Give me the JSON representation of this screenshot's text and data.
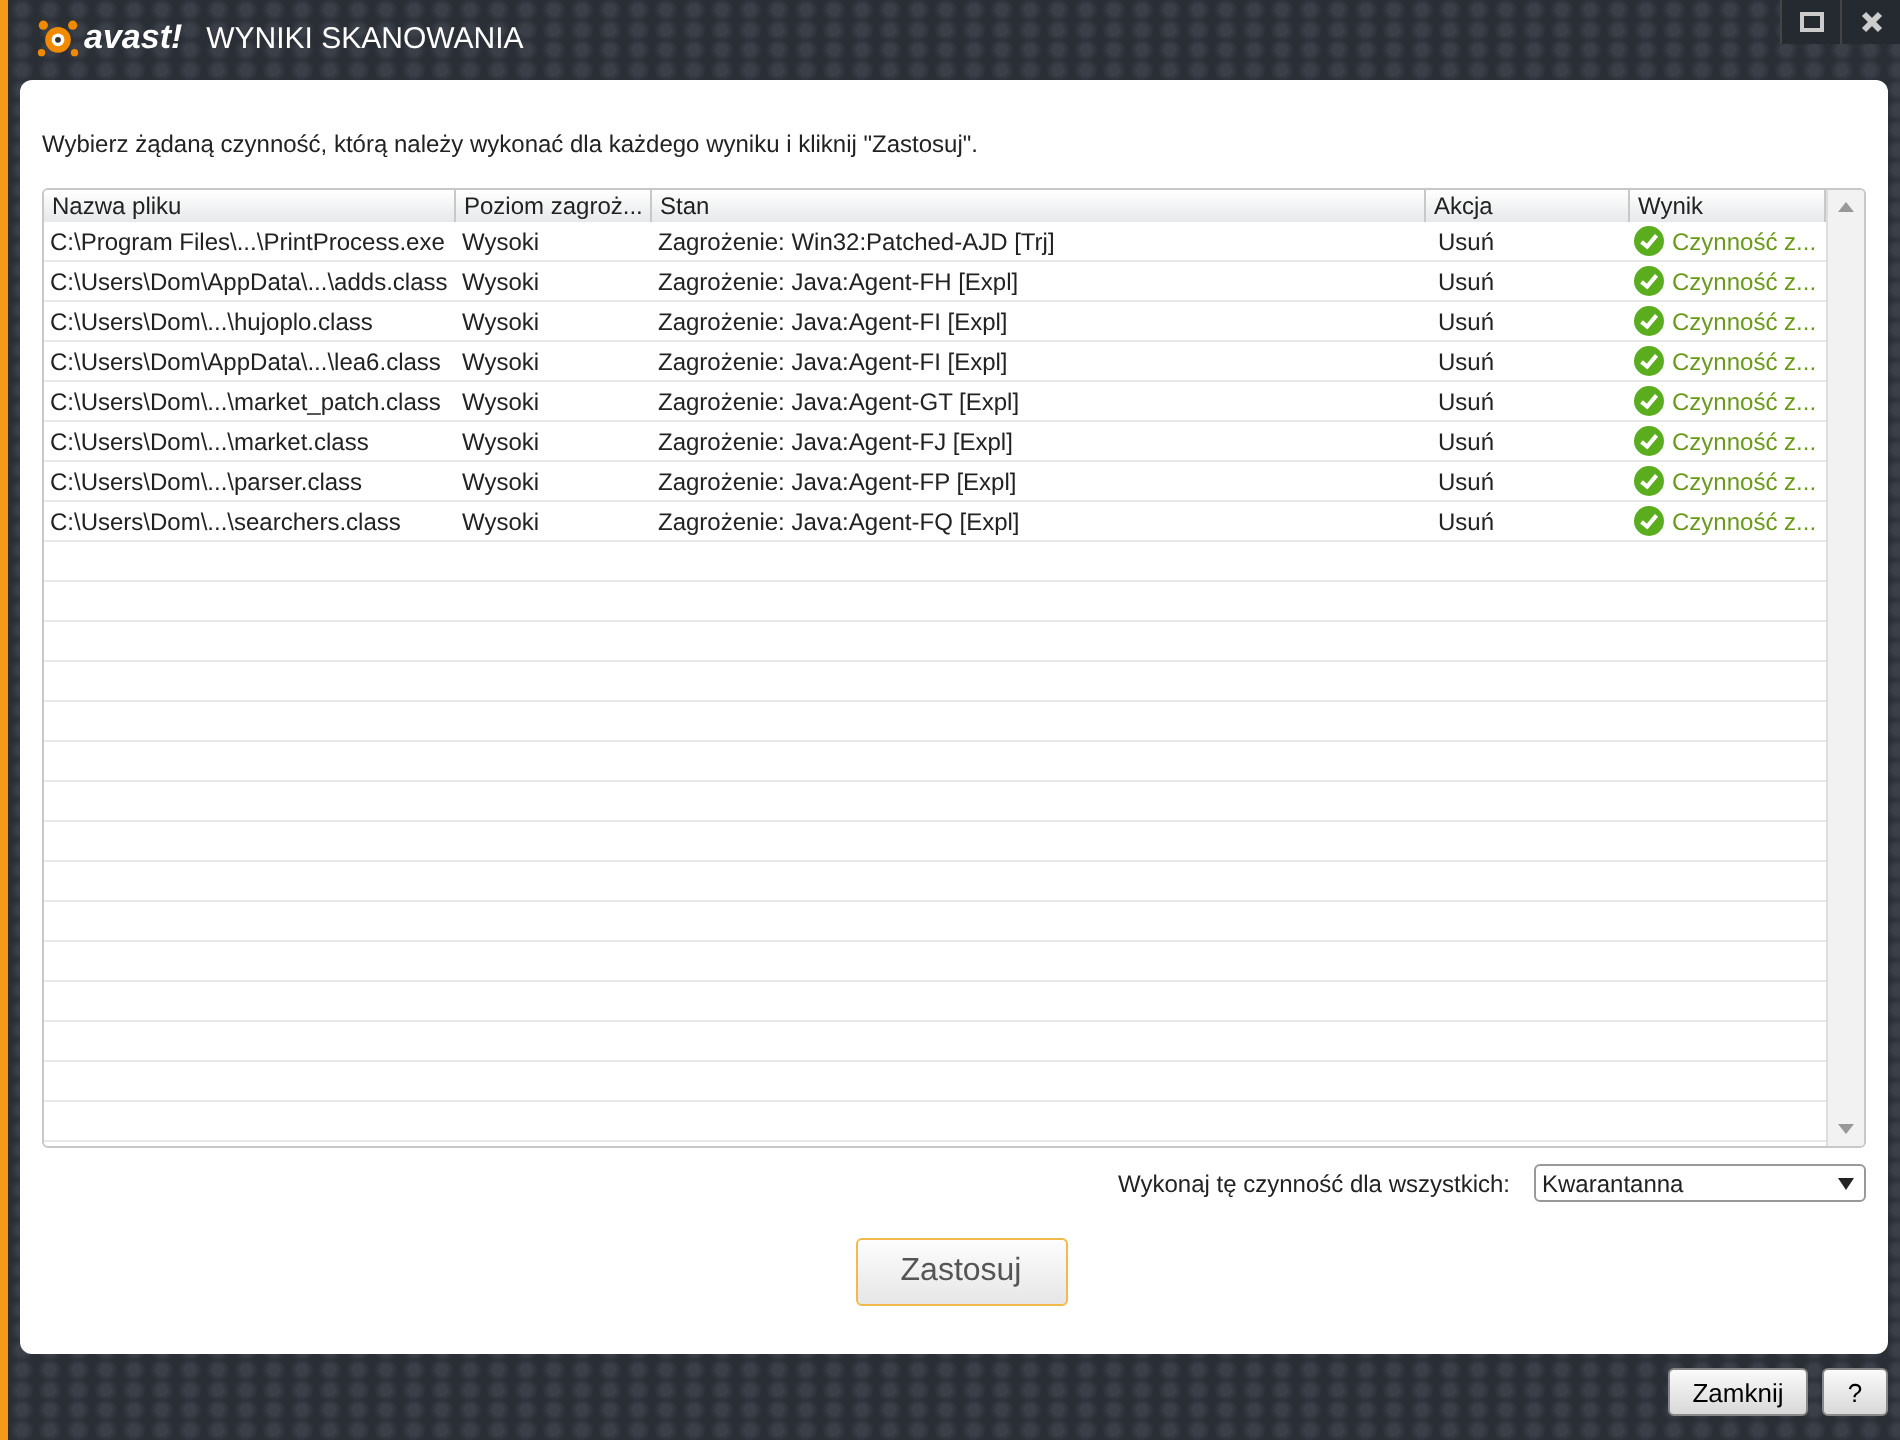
{
  "window": {
    "logo": "avast!",
    "title": "WYNIKI SKANOWANIA"
  },
  "instruction": "Wybierz żądaną czynność, którą należy wykonać dla każdego wyniku i kliknij \"Zastosuj\".",
  "table": {
    "columns": [
      "Nazwa pliku",
      "Poziom zagroż...",
      "Stan",
      "Akcja",
      "Wynik"
    ],
    "rows": [
      {
        "file": "C:\\Program Files\\...\\PrintProcess.exe",
        "level": "Wysoki",
        "status": "Zagrożenie: Win32:Patched-AJD [Trj]",
        "action": "Usuń",
        "result": "Czynność z..."
      },
      {
        "file": "C:\\Users\\Dom\\AppData\\...\\adds.class",
        "level": "Wysoki",
        "status": "Zagrożenie: Java:Agent-FH [Expl]",
        "action": "Usuń",
        "result": "Czynność z..."
      },
      {
        "file": "C:\\Users\\Dom\\...\\hujoplo.class",
        "level": "Wysoki",
        "status": "Zagrożenie: Java:Agent-FI [Expl]",
        "action": "Usuń",
        "result": "Czynność z..."
      },
      {
        "file": "C:\\Users\\Dom\\AppData\\...\\lea6.class",
        "level": "Wysoki",
        "status": "Zagrożenie: Java:Agent-FI [Expl]",
        "action": "Usuń",
        "result": "Czynność z..."
      },
      {
        "file": "C:\\Users\\Dom\\...\\market_patch.class",
        "level": "Wysoki",
        "status": "Zagrożenie: Java:Agent-GT [Expl]",
        "action": "Usuń",
        "result": "Czynność z..."
      },
      {
        "file": "C:\\Users\\Dom\\...\\market.class",
        "level": "Wysoki",
        "status": "Zagrożenie: Java:Agent-FJ [Expl]",
        "action": "Usuń",
        "result": "Czynność z..."
      },
      {
        "file": "C:\\Users\\Dom\\...\\parser.class",
        "level": "Wysoki",
        "status": "Zagrożenie: Java:Agent-FP [Expl]",
        "action": "Usuń",
        "result": "Czynność z..."
      },
      {
        "file": "C:\\Users\\Dom\\...\\searchers.class",
        "level": "Wysoki",
        "status": "Zagrożenie: Java:Agent-FQ [Expl]",
        "action": "Usuń",
        "result": "Czynność z..."
      }
    ]
  },
  "apply_all": {
    "label": "Wykonaj tę czynność dla wszystkich:",
    "value": "Kwarantanna"
  },
  "apply_button": "Zastosuj",
  "footer_buttons": [
    "Zamknij",
    "?"
  ]
}
